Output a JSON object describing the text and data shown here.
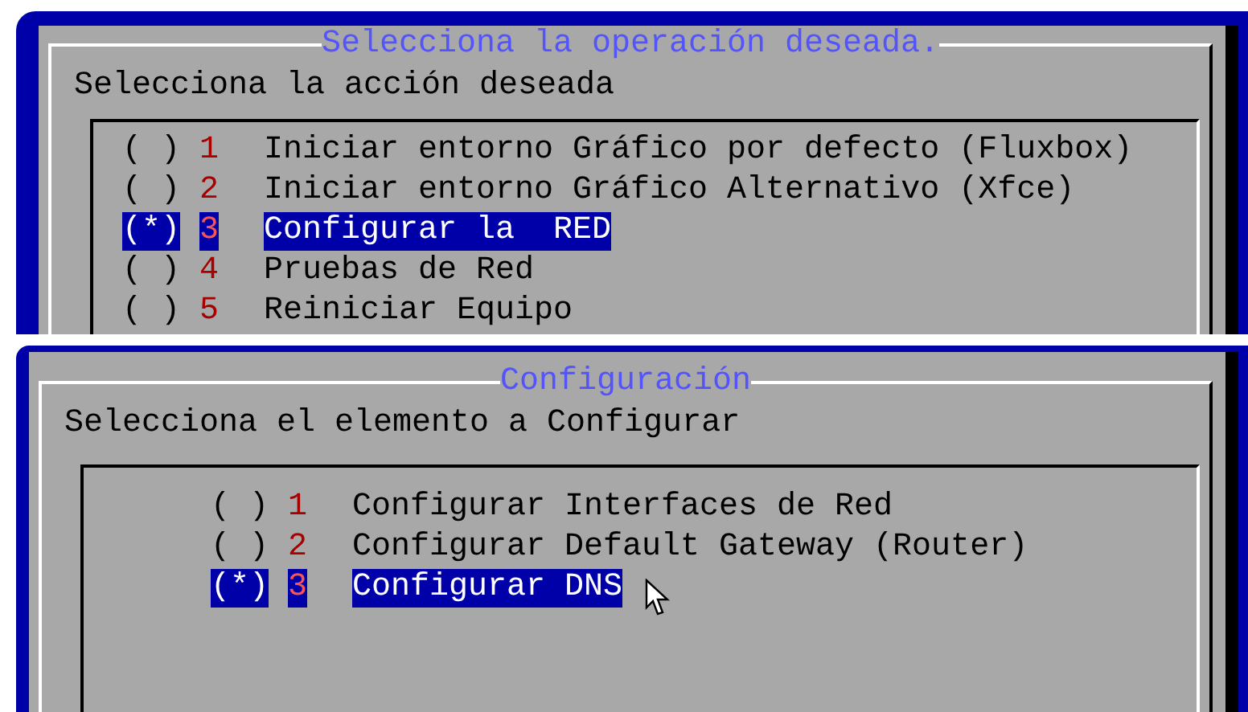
{
  "panels": [
    {
      "title": "Selecciona la operación deseada.",
      "prompt": "Selecciona la acción deseada",
      "options": [
        {
          "marker": "( )",
          "number": "1",
          "label": "Iniciar entorno Gráfico por defecto (Fluxbox)",
          "selected": false
        },
        {
          "marker": "( )",
          "number": "2",
          "label": "Iniciar entorno Gráfico Alternativo (Xfce)",
          "selected": false
        },
        {
          "marker": "(*)",
          "number": "3",
          "label": "Configurar la  RED",
          "selected": true
        },
        {
          "marker": "( )",
          "number": "4",
          "label": "Pruebas de Red",
          "selected": false
        },
        {
          "marker": "( )",
          "number": "5",
          "label": "Reiniciar Equipo",
          "selected": false
        }
      ]
    },
    {
      "title": "Configuración",
      "prompt": "Selecciona el elemento a Configurar",
      "options": [
        {
          "marker": "( )",
          "number": "1",
          "label": "Configurar Interfaces de Red",
          "selected": false
        },
        {
          "marker": "( )",
          "number": "2",
          "label": "Configurar Default Gateway (Router)",
          "selected": false
        },
        {
          "marker": "(*)",
          "number": "3",
          "label": "Configurar DNS",
          "selected": true
        }
      ]
    }
  ]
}
